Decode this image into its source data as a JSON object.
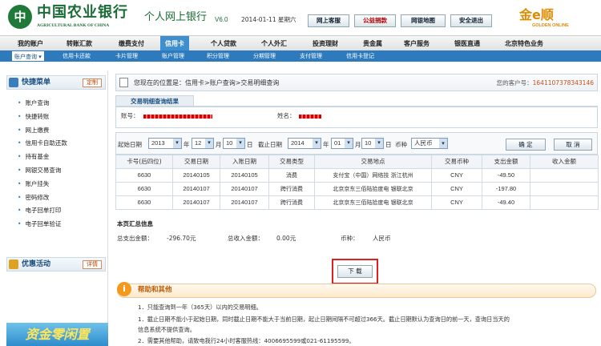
{
  "header": {
    "logo_glyph": "中",
    "bank_name": "中国农业银行",
    "bank_name_en": "AGRICULTURAL BANK OF CHINA",
    "product": "个人网上银行",
    "version": "V6.0",
    "date": "2014-01-11 星期六",
    "buttons": [
      "网上客服",
      "公益捐款",
      "网银地图",
      "安全退出"
    ],
    "brand": "金e顺",
    "brand_en": "GOLDEN ONLINE"
  },
  "nav": {
    "items": [
      "我的账户",
      "转账汇款",
      "缴费支付",
      "信用卡",
      "个人贷款",
      "个人外汇",
      "投资理财",
      "贵金属",
      "客户服务",
      "银医直通",
      "北京特色业务"
    ],
    "active": "信用卡"
  },
  "subnav": {
    "items": [
      "账户查询",
      "信用卡还款",
      "卡片管理",
      "账户管理",
      "积分管理",
      "分期管理",
      "支付管理",
      "信用卡登记"
    ]
  },
  "sidebar": {
    "quick_menu_title": "快捷菜单",
    "customize_label": "定制",
    "items": [
      "账户查询",
      "快捷转账",
      "网上缴费",
      "信用卡自助还款",
      "持有基金",
      "网银交易查询",
      "账户挂失",
      "密码修改",
      "电子回单打印",
      "电子回单验证"
    ],
    "promo_title": "优惠活动",
    "details_label": "详情",
    "promo_banner": "资金零闲置"
  },
  "breadcrumb": {
    "text": "您现在的位置是：信用卡>账户查询>交易明细查询",
    "customer_label": "您的客户号：",
    "customer_no": "1641107378343146"
  },
  "result_tab": "交易明细查询结果",
  "account": {
    "account_label": "账号：",
    "name_label": "姓名："
  },
  "query": {
    "start_label": "起始日期",
    "end_label": "截止日期",
    "start": {
      "year": "2013",
      "month": "12",
      "day": "10"
    },
    "end": {
      "year": "2014",
      "month": "01",
      "day": "10"
    },
    "year_unit": "年",
    "month_unit": "月",
    "day_unit": "日",
    "currency_label": "币种",
    "currency": "人民币",
    "confirm": "确 定",
    "cancel": "取 消"
  },
  "table": {
    "headers": [
      "卡号(后四位)",
      "交易日期",
      "入账日期",
      "交易类型",
      "交易地点",
      "交易币种",
      "支出金额",
      "收入金额"
    ],
    "rows": [
      [
        "6630",
        "20140105",
        "20140105",
        "消费",
        "支付宝（中国）网络技 浙江杭州",
        "CNY",
        "-49.50",
        ""
      ],
      [
        "6630",
        "20140107",
        "20140107",
        "跨行消费",
        "北京京东三佰陆拾度电 银联北京",
        "CNY",
        "-197.80",
        ""
      ],
      [
        "6630",
        "20140107",
        "20140107",
        "跨行消费",
        "北京京东三佰陆拾度电 银联北京",
        "CNY",
        "-49.40",
        ""
      ]
    ]
  },
  "summary": {
    "title": "本页汇总信息",
    "expense_label": "总支出金额：",
    "expense": "-296.70元",
    "income_label": "总收入金额：",
    "income": "0.00元",
    "currency_label": "币种：",
    "currency": "人民币"
  },
  "download": "下 载",
  "help": {
    "icon": "i",
    "title": "帮助和其他",
    "lines": [
      "1．只能查询到一年（365天）以内的交易明细。",
      "1．截止日期不能小于起始日期，同时截止日期不能大于当前日期，起止日期间隔不可超过366天。截止日期默认为查询日的前一天，查询日当天的",
      "信息系统不提供查询。",
      "2．需要其他帮助，请致电我行24小时客服热线：4006695599或021-61195599。"
    ]
  }
}
